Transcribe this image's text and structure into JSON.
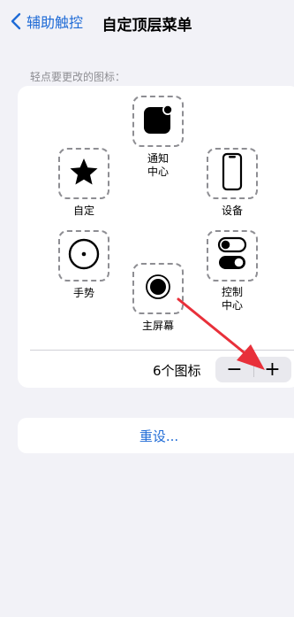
{
  "nav": {
    "back_label": "辅助触控",
    "title": "自定顶层菜单"
  },
  "section_label": "轻点要更改的图标：",
  "icons": [
    {
      "label": "通知中心",
      "icon": "notification-icon"
    },
    {
      "label": "自定",
      "icon": "star-icon"
    },
    {
      "label": "设备",
      "icon": "device-icon"
    },
    {
      "label": "手势",
      "icon": "gesture-icon"
    },
    {
      "label": "主屏幕",
      "icon": "home-icon"
    },
    {
      "label": "控制中心",
      "icon": "control-center-icon"
    }
  ],
  "labels": {
    "notification": [
      "通知",
      "中心"
    ],
    "control": [
      "控制",
      "中心"
    ]
  },
  "count_label": "6个图标",
  "stepper": {
    "minus": "−",
    "plus": "+"
  },
  "reset_label": "重设...",
  "colors": {
    "accent": "#1f6bd6",
    "arrow": "#e8303a",
    "background": "#f2f2f7"
  }
}
